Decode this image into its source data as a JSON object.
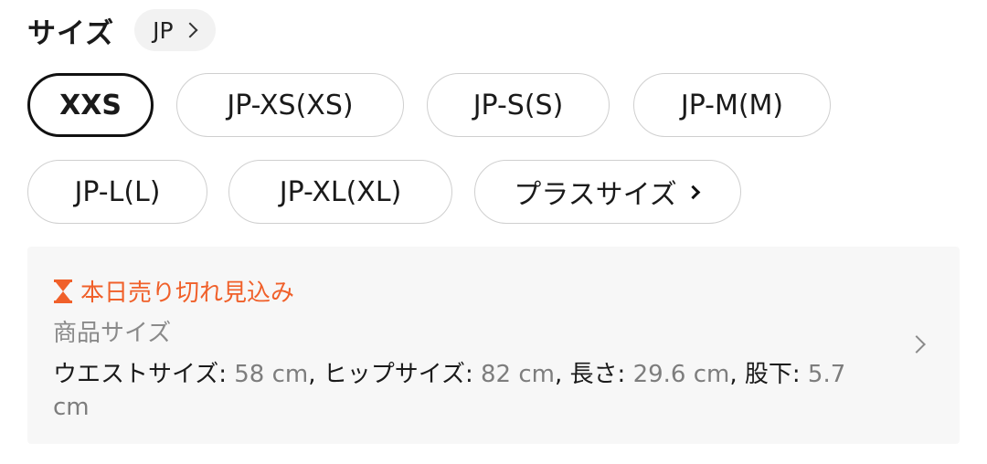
{
  "size_section": {
    "title": "サイズ",
    "region": "JP"
  },
  "size_options": [
    {
      "label": "XXS",
      "selected": true
    },
    {
      "label": "JP-XS(XS)",
      "selected": false
    },
    {
      "label": "JP-S(S)",
      "selected": false
    },
    {
      "label": "JP-M(M)",
      "selected": false
    },
    {
      "label": "JP-L(L)",
      "selected": false
    },
    {
      "label": "JP-XL(XL)",
      "selected": false
    },
    {
      "label": "プラスサイズ",
      "selected": false
    }
  ],
  "info": {
    "alert": "本日売り切れ見込み",
    "alert_color": "#f0602a",
    "subtitle": "商品サイズ",
    "measurements": [
      {
        "label": "ウエストサイズ: ",
        "value": "58 cm"
      },
      {
        "label": "ヒップサイズ: ",
        "value": "82 cm"
      },
      {
        "label": "長さ: ",
        "value": "29.6 cm"
      },
      {
        "label": "股下: ",
        "value": "5.7 cm"
      }
    ]
  }
}
